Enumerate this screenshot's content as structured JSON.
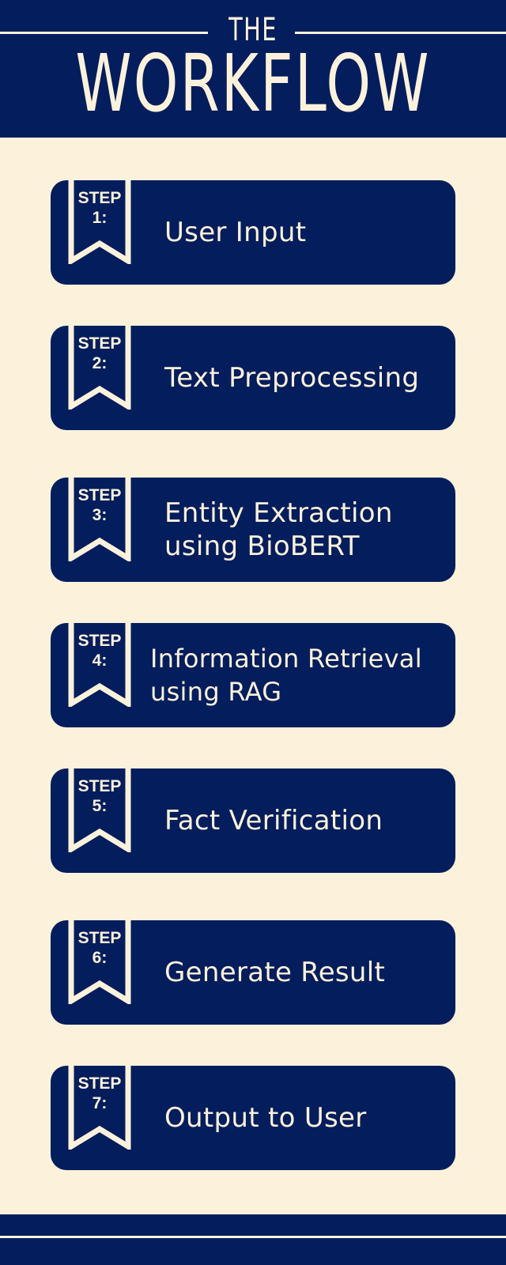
{
  "header": {
    "title_small": "THE",
    "title_big": "WORKFLOW"
  },
  "steps": [
    {
      "tag_word": "STEP",
      "tag_num": "1:",
      "label_lines": [
        "User Input",
        ""
      ]
    },
    {
      "tag_word": "STEP",
      "tag_num": "2:",
      "label_lines": [
        "Text Preprocessing",
        ""
      ]
    },
    {
      "tag_word": "STEP",
      "tag_num": "3:",
      "label_lines": [
        "Entity Extraction",
        "using BioBERT"
      ]
    },
    {
      "tag_word": "STEP",
      "tag_num": "4:",
      "label_lines": [
        "Information Retrieval",
        "using RAG"
      ]
    },
    {
      "tag_word": "STEP",
      "tag_num": "5:",
      "label_lines": [
        "Fact Verification",
        ""
      ]
    },
    {
      "tag_word": "STEP",
      "tag_num": "6:",
      "label_lines": [
        "Generate Result",
        ""
      ]
    },
    {
      "tag_word": "STEP",
      "tag_num": "7:",
      "label_lines": [
        "Output to User",
        ""
      ]
    }
  ],
  "colors": {
    "background": "#fcf2dc",
    "navy": "#041d5c",
    "cream": "#fcf2dc"
  },
  "icons": {
    "step_badge": "bookmark-ribbon-icon"
  }
}
